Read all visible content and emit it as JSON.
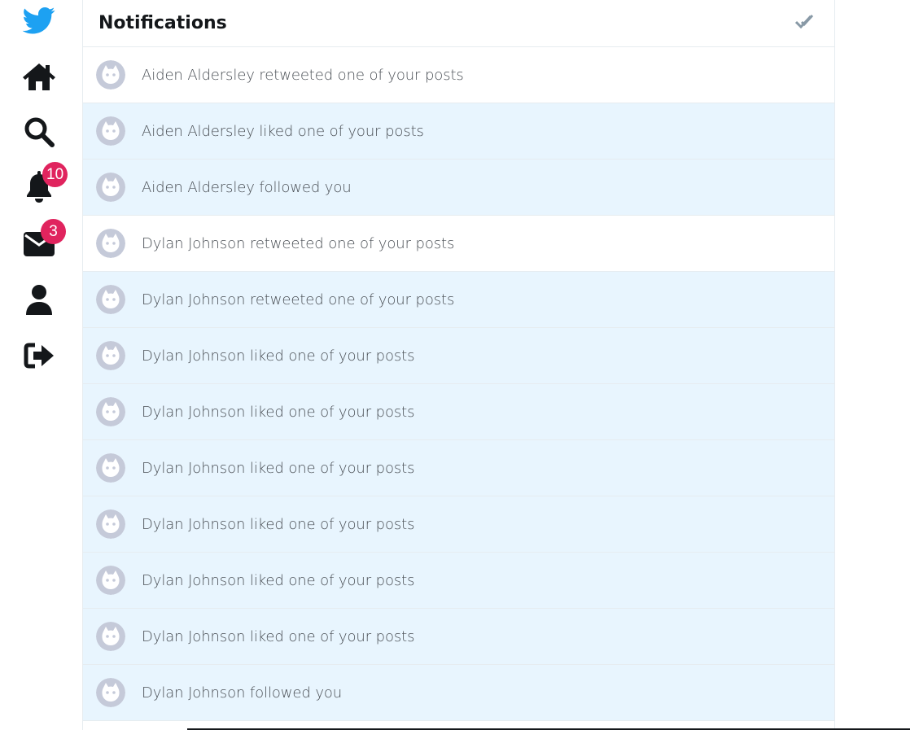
{
  "sidebar": {
    "items": [
      {
        "name": "logo",
        "icon": "bird-icon",
        "color": "#1da1f2"
      },
      {
        "name": "home",
        "icon": "home-icon"
      },
      {
        "name": "search",
        "icon": "search-icon"
      },
      {
        "name": "notifications",
        "icon": "bell-icon",
        "badge": "10"
      },
      {
        "name": "messages",
        "icon": "envelope-icon",
        "badge": "3"
      },
      {
        "name": "profile",
        "icon": "user-icon"
      },
      {
        "name": "logout",
        "icon": "logout-icon"
      }
    ]
  },
  "header": {
    "title": "Notifications",
    "mark_all_read_icon": "double-check-icon"
  },
  "notifications": [
    {
      "text": "Aiden Aldersley retweeted one of your posts",
      "unread": false
    },
    {
      "text": "Aiden Aldersley liked one of your posts",
      "unread": true
    },
    {
      "text": "Aiden Aldersley followed you",
      "unread": true
    },
    {
      "text": "Dylan Johnson retweeted one of your posts",
      "unread": false
    },
    {
      "text": "Dylan Johnson retweeted one of your posts",
      "unread": true
    },
    {
      "text": "Dylan Johnson liked one of your posts",
      "unread": true
    },
    {
      "text": "Dylan Johnson liked one of your posts",
      "unread": true
    },
    {
      "text": "Dylan Johnson liked one of your posts",
      "unread": true
    },
    {
      "text": "Dylan Johnson liked one of your posts",
      "unread": true
    },
    {
      "text": "Dylan Johnson liked one of your posts",
      "unread": true
    },
    {
      "text": "Dylan Johnson liked one of your posts",
      "unread": true
    },
    {
      "text": "Dylan Johnson followed you",
      "unread": true
    }
  ],
  "colors": {
    "accent": "#1da1f2",
    "badge": "#e0245e",
    "unread_bg": "#e8f5fe",
    "icon": "#14171a"
  }
}
